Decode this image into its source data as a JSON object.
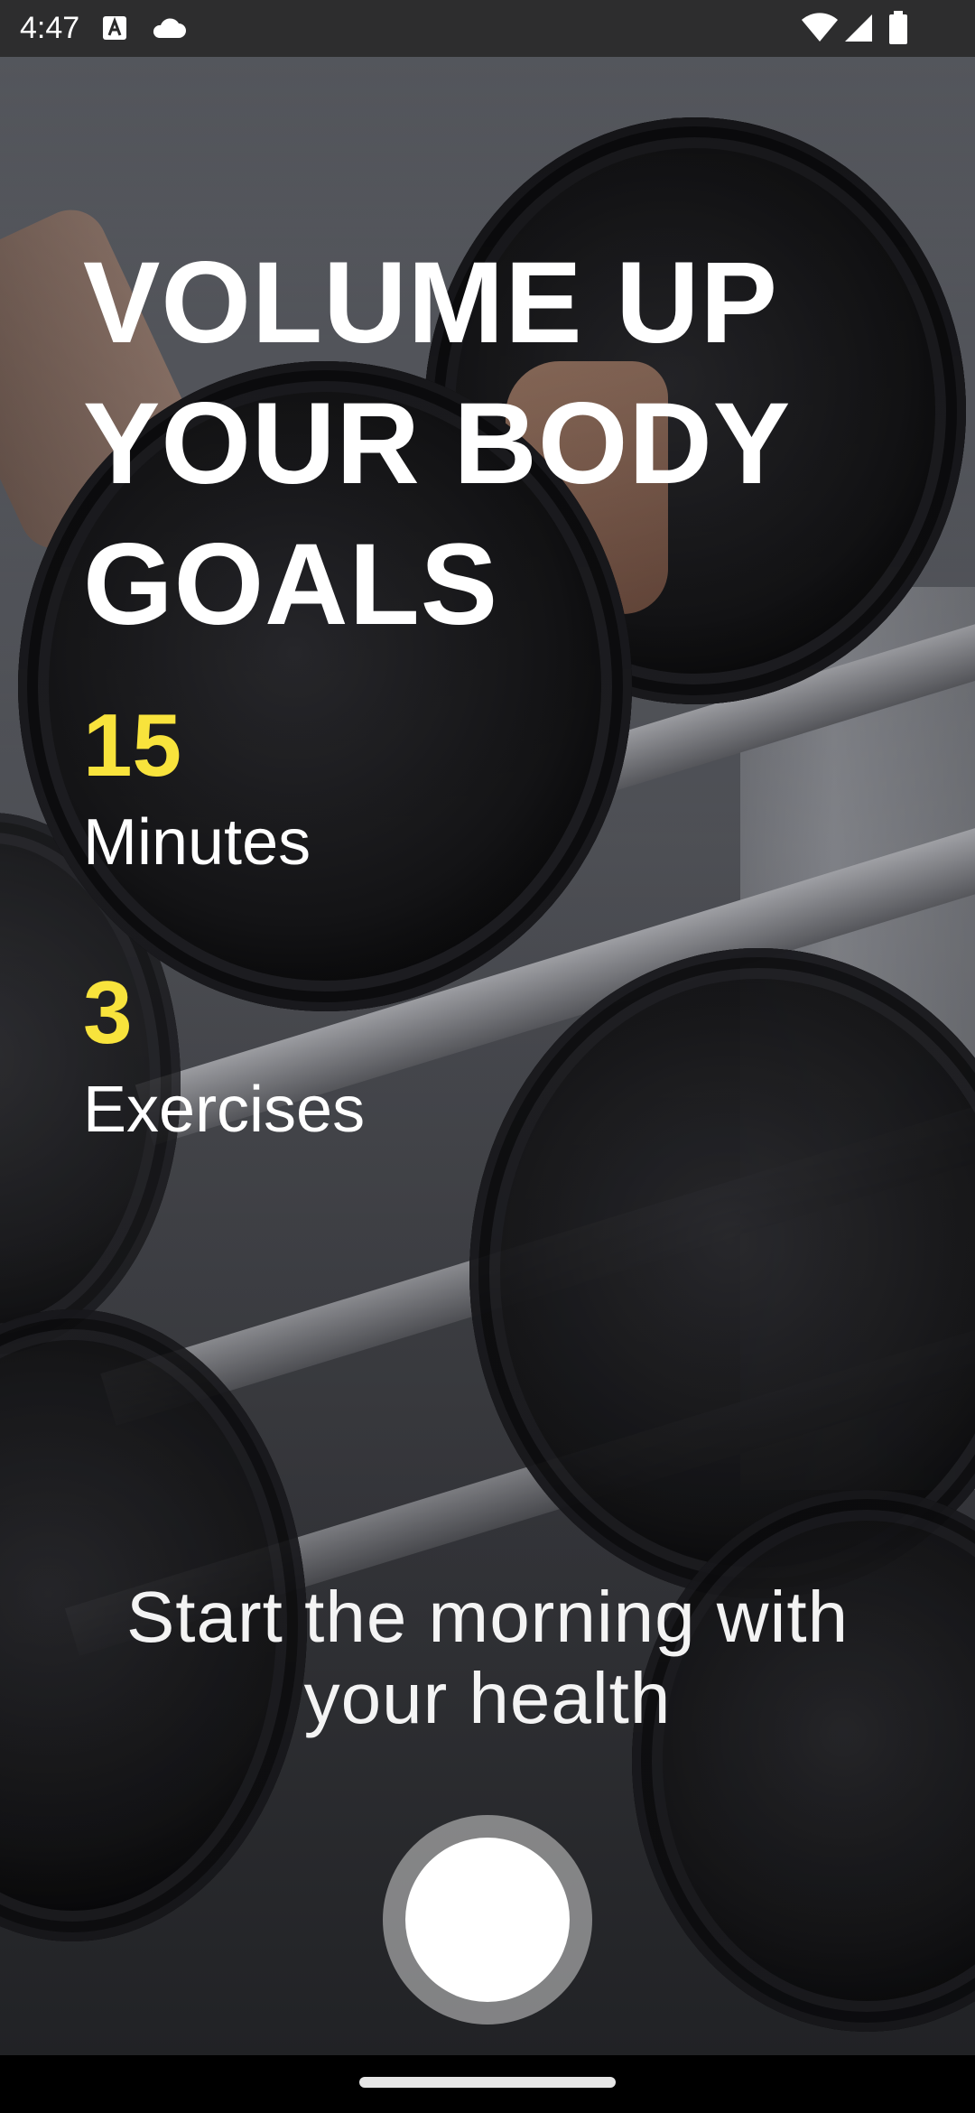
{
  "status_bar": {
    "time": "4:47",
    "left_icons": [
      "keyboard-a-icon",
      "cloud-icon"
    ],
    "right_icons": [
      "wifi-icon",
      "signal-icon",
      "battery-icon"
    ]
  },
  "hero": {
    "headline_lines": [
      "VOLUME UP",
      "YOUR BODY",
      "GOALS"
    ],
    "background": "dumbbell-rack-photo"
  },
  "stats": [
    {
      "value": "15",
      "label": "Minutes"
    },
    {
      "value": "3",
      "label": "Exercises"
    }
  ],
  "tagline": "Start the morning with your health",
  "colors": {
    "accent": "#f8e33c",
    "text": "#ffffff",
    "status_bar": "#282828"
  },
  "start_button": {
    "icon": "circle-button"
  }
}
